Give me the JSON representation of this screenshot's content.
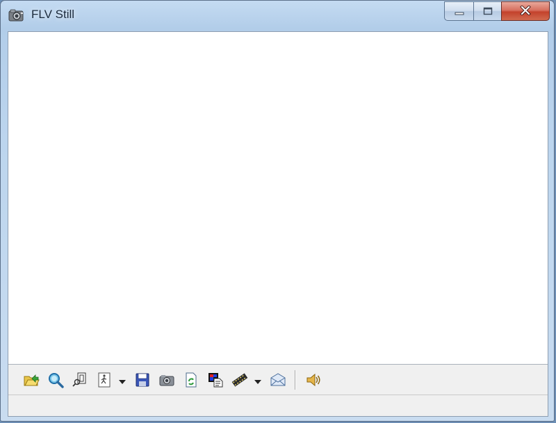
{
  "window": {
    "title": "FLV Still",
    "app_icon": "camera-icon"
  },
  "caption_buttons": [
    {
      "name": "minimize",
      "icon": "minimize-icon"
    },
    {
      "name": "maximize",
      "icon": "maximize-icon"
    },
    {
      "name": "close",
      "icon": "close-icon"
    }
  ],
  "toolbar": {
    "items": [
      {
        "name": "open",
        "icon": "open-folder-icon"
      },
      {
        "name": "zoom",
        "icon": "magnify-icon"
      },
      {
        "name": "find",
        "icon": "search-document-icon"
      },
      {
        "name": "step",
        "icon": "walking-figure-icon",
        "dropdown": true
      },
      {
        "name": "save",
        "icon": "floppy-disk-icon"
      },
      {
        "name": "capture",
        "icon": "camera-icon"
      },
      {
        "name": "refresh",
        "icon": "refresh-document-icon"
      },
      {
        "name": "color",
        "icon": "color-document-icon"
      },
      {
        "name": "film",
        "icon": "filmstrip-icon",
        "dropdown": true
      },
      {
        "name": "mail",
        "icon": "envelope-icon"
      },
      {
        "name": "sound",
        "icon": "speaker-icon"
      }
    ]
  },
  "colors": {
    "titlebar": "#bcd5ee",
    "close_button": "#c4422c",
    "view_background": "#ffffff",
    "panel_background": "#f0f0f0"
  }
}
